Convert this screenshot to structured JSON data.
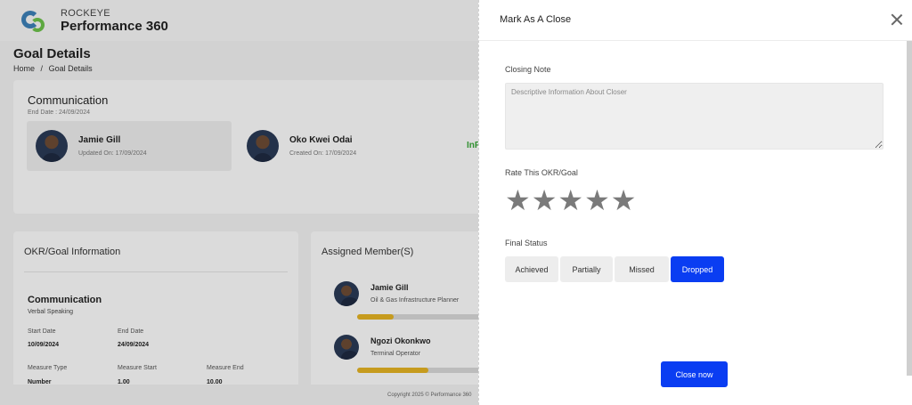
{
  "app": {
    "brand_top": "ROCKEYE",
    "brand_bottom": "Performance 360"
  },
  "page": {
    "title": "Goal Details",
    "breadcrumb": [
      "Home",
      "/",
      "Goal Details"
    ]
  },
  "goal_card": {
    "name": "Communication",
    "end_date": "End Date : 24/09/2024",
    "people": [
      {
        "name": "Jamie Gill",
        "meta": "Updated On: 17/09/2024"
      },
      {
        "name": "Oko Kwei Odai",
        "meta": "Created On: 17/09/2024"
      }
    ],
    "status_partial": "InP"
  },
  "okr_info": {
    "title": "OKR/Goal Information",
    "name": "Communication",
    "subtitle": "Verbal Speaking",
    "fields": [
      {
        "label": "Start Date",
        "value": "10/09/2024"
      },
      {
        "label": "End Date",
        "value": "24/09/2024"
      },
      {
        "label": "Measure Type",
        "value": "Number"
      },
      {
        "label": "Measure Start",
        "value": "1.00"
      },
      {
        "label": "Measure End",
        "value": "10.00"
      }
    ]
  },
  "assigned": {
    "title": "Assigned Member(S)",
    "members": [
      {
        "name": "Jamie Gill",
        "role": "Oil & Gas Infrastructure Planner",
        "progress": 0.27
      },
      {
        "name": "Ngozi Okonkwo",
        "role": "Terminal Operator",
        "progress": 0.53
      }
    ]
  },
  "footer": {
    "copyright": "Copyright 2025 © Performance 360"
  },
  "modal": {
    "title": "Mark As A Close",
    "closing_note_label": "Closing Note",
    "closing_note_placeholder": "Descriptive Information About Closer",
    "closing_note_value": "",
    "rate_label": "Rate This OKR/Goal",
    "rating": 0,
    "stars": [
      "★",
      "★",
      "★",
      "★",
      "★"
    ],
    "final_status_label": "Final Status",
    "statuses": [
      "Achieved",
      "Partially",
      "Missed",
      "Dropped"
    ],
    "selected_status": "Dropped",
    "submit_label": "Close now"
  },
  "colors": {
    "primary": "#0a3df2",
    "progress": "#e2b123",
    "status_green": "#3aa53a"
  }
}
